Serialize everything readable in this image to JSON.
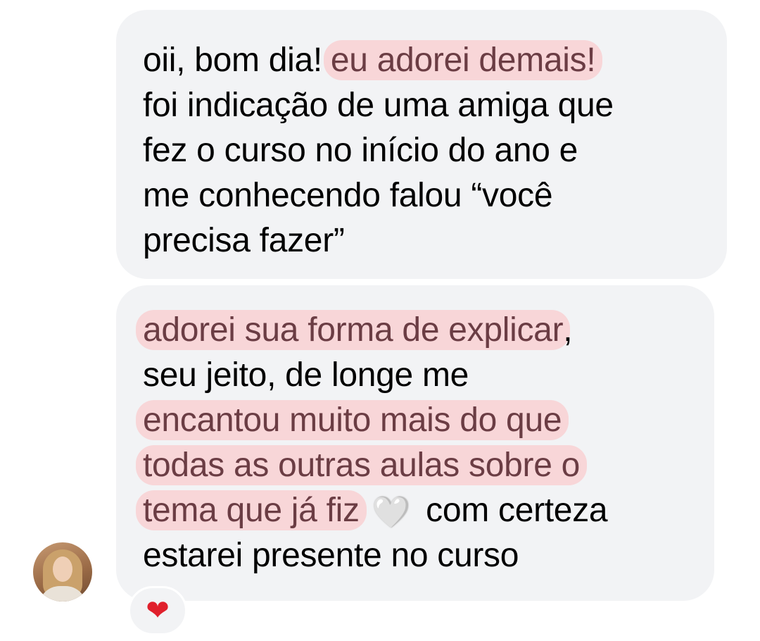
{
  "messages": [
    {
      "lines": [
        {
          "parts": [
            {
              "text": "oii, bom dia!",
              "highlight": false
            },
            {
              "text": "eu adorei demais!",
              "highlight": true
            }
          ]
        },
        {
          "parts": [
            {
              "text": "foi indicação de uma amiga que",
              "highlight": false
            }
          ]
        },
        {
          "parts": [
            {
              "text": "fez o curso no início do ano e",
              "highlight": false
            }
          ]
        },
        {
          "parts": [
            {
              "text": "me conhecendo falou “você",
              "highlight": false
            }
          ]
        },
        {
          "parts": [
            {
              "text": "precisa fazer”",
              "highlight": false
            }
          ]
        }
      ]
    },
    {
      "lines": [
        {
          "parts": [
            {
              "text": "adorei sua forma de explicar",
              "highlight": true
            },
            {
              "text": ",",
              "highlight": false
            }
          ]
        },
        {
          "parts": [
            {
              "text": "seu jeito, de longe me",
              "highlight": false
            }
          ]
        },
        {
          "parts": [
            {
              "text": "encantou muito mais do que",
              "highlight": true
            }
          ]
        },
        {
          "parts": [
            {
              "text": "todas as outras aulas sobre o",
              "highlight": true
            }
          ]
        },
        {
          "parts": [
            {
              "text": "tema que já fiz",
              "highlight": true
            },
            {
              "text": "🤍",
              "highlight": false,
              "emoji": "white-heart"
            },
            {
              "text": "com certeza",
              "highlight": false
            }
          ]
        },
        {
          "parts": [
            {
              "text": "estarei presente no curso",
              "highlight": false
            }
          ]
        }
      ],
      "reaction": {
        "emoji": "❤",
        "icon": "red-heart-icon"
      }
    }
  ],
  "avatar": {
    "icon": "user-avatar"
  },
  "colors": {
    "bubble": "#f2f3f5",
    "highlight_bg": "#f8d6d8",
    "highlight_text": "#6b3d44",
    "reaction_heart": "#e0202c"
  }
}
